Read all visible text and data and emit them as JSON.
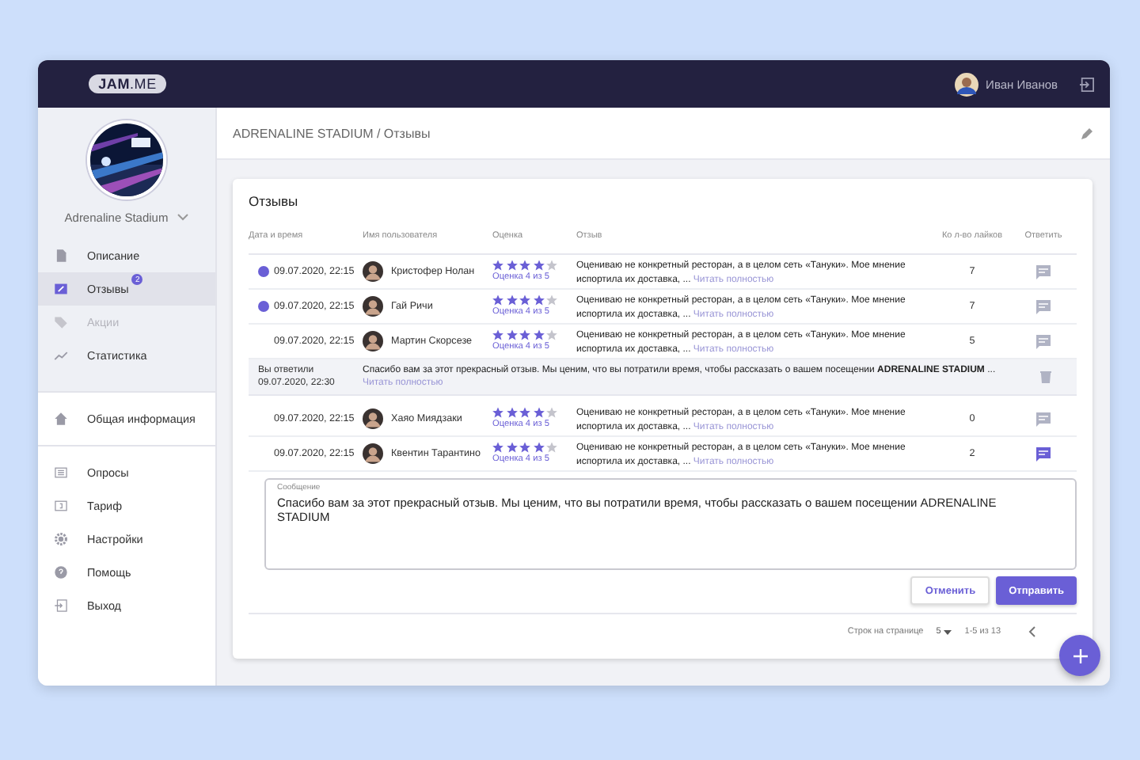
{
  "topbar": {
    "logo": "**JAM**.ME",
    "user_name": "Иван Иванов"
  },
  "sidebar": {
    "venue_name": "Adrenaline Stadium",
    "groups": [
      [
        {
          "label": "Описание",
          "selected": false,
          "disabled": false
        },
        {
          "label": "Отзывы",
          "selected": true,
          "disabled": false,
          "badge": "2"
        },
        {
          "label": "Акции",
          "selected": false,
          "disabled": true
        },
        {
          "label": "Статистика",
          "selected": false,
          "disabled": false
        }
      ],
      [
        {
          "label": "Общая информация",
          "selected": false,
          "disabled": false
        }
      ],
      [
        {
          "label": "Опросы",
          "selected": false,
          "disabled": false
        },
        {
          "label": "Тариф",
          "selected": false,
          "disabled": false
        },
        {
          "label": "Настройки",
          "selected": false,
          "disabled": false
        },
        {
          "label": "Помощь",
          "selected": false,
          "disabled": false
        },
        {
          "label": "Выход",
          "selected": false,
          "disabled": false
        }
      ]
    ]
  },
  "breadcrumb": "ADRENALINE STADIUM / Отзывы",
  "card": {
    "title": "Отзывы",
    "columns": [
      "Дата и время",
      "Имя пользователя",
      "Оценка",
      "Отзыв",
      "Ко л-во лайков",
      "Ответить"
    ],
    "rows": [
      {
        "kind": "review",
        "unread": true,
        "date": "09.07.2020, 22:15",
        "user": "Кристофер Нолан",
        "stars": 4,
        "rating_text": "Оценка 4 из 5",
        "text": "Оцениваю не конкретный ресторан, а в целом сеть «Тануки». Мое мнение испортила их доставка,  ...",
        "more": "Читать полностью",
        "likes": "7",
        "reply_active": false
      },
      {
        "kind": "review",
        "unread": true,
        "date": "09.07.2020, 22:15",
        "user": "Гай Ричи",
        "stars": 4,
        "rating_text": "Оценка 4 из 5",
        "text": "Оцениваю не конкретный ресторан, а в целом сеть «Тануки». Мое мнение испортила их доставка,  ...",
        "more": "Читать полностью",
        "likes": "7",
        "reply_active": false
      },
      {
        "kind": "review",
        "unread": false,
        "date": "09.07.2020, 22:15",
        "user": "Мартин Скорсезе",
        "stars": 4,
        "rating_text": "Оценка 4 из 5",
        "text": "Оцениваю не конкретный ресторан, а в целом сеть «Тануки». Мое мнение испортила их доставка,  ...",
        "more": "Читать полностью",
        "likes": "5",
        "reply_active": false
      },
      {
        "kind": "reply",
        "label": "Вы ответили",
        "reply_date": "09.07.2020, 22:30",
        "reply_text": "Спасибо вам за этот прекрасный отзыв. Мы ценим, что вы потратили время, чтобы рассказать о вашем посещении **ADRENALINE STADIUM**  ...",
        "reply_more": "Читать полностью"
      },
      {
        "kind": "review",
        "unread": false,
        "date": "09.07.2020, 22:15",
        "user": "Хаяо Миядзаки",
        "stars": 4,
        "rating_text": "Оценка 4 из 5",
        "text": "Оцениваю не конкретный ресторан, а в целом сеть «Тануки». Мое мнение испортила их доставка,  ...",
        "more": "Читать полностью",
        "likes": "0",
        "reply_active": false
      },
      {
        "kind": "review",
        "unread": false,
        "date": "09.07.2020, 22:15",
        "user": "Квентин Тарантино",
        "stars": 4,
        "rating_text": "Оценка 4 из 5",
        "text": "Оцениваю не конкретный ресторан, а в целом сеть «Тануки». Мое мнение испортила их доставка,  ...",
        "more": "Читать полностью",
        "likes": "2",
        "reply_active": true
      }
    ],
    "message": {
      "label": "Сообщение",
      "value": "Спасибо вам за этот прекрасный отзыв. Мы ценим, что вы потратили время, чтобы рассказать о вашем посещении ADRENALINE STADIUM"
    },
    "buttons": {
      "cancel": "Отменить",
      "send": "Отправить"
    },
    "pagination": {
      "rows_label": "Строк на странице",
      "rows_value": "5",
      "range": "1-5 из 13"
    }
  }
}
